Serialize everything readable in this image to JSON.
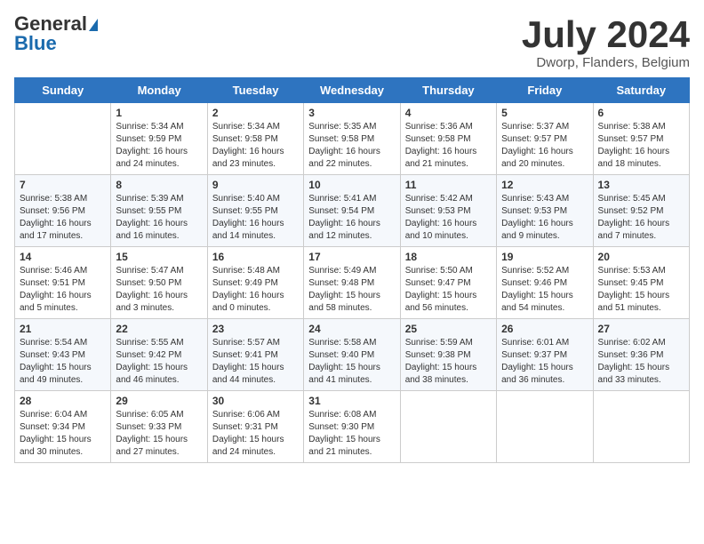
{
  "header": {
    "logo_general": "General",
    "logo_blue": "Blue",
    "month_title": "July 2024",
    "location": "Dworp, Flanders, Belgium"
  },
  "weekdays": [
    "Sunday",
    "Monday",
    "Tuesday",
    "Wednesday",
    "Thursday",
    "Friday",
    "Saturday"
  ],
  "weeks": [
    [
      {
        "day": "",
        "sunrise": "",
        "sunset": "",
        "daylight": ""
      },
      {
        "day": "1",
        "sunrise": "Sunrise: 5:34 AM",
        "sunset": "Sunset: 9:59 PM",
        "daylight": "Daylight: 16 hours and 24 minutes."
      },
      {
        "day": "2",
        "sunrise": "Sunrise: 5:34 AM",
        "sunset": "Sunset: 9:58 PM",
        "daylight": "Daylight: 16 hours and 23 minutes."
      },
      {
        "day": "3",
        "sunrise": "Sunrise: 5:35 AM",
        "sunset": "Sunset: 9:58 PM",
        "daylight": "Daylight: 16 hours and 22 minutes."
      },
      {
        "day": "4",
        "sunrise": "Sunrise: 5:36 AM",
        "sunset": "Sunset: 9:58 PM",
        "daylight": "Daylight: 16 hours and 21 minutes."
      },
      {
        "day": "5",
        "sunrise": "Sunrise: 5:37 AM",
        "sunset": "Sunset: 9:57 PM",
        "daylight": "Daylight: 16 hours and 20 minutes."
      },
      {
        "day": "6",
        "sunrise": "Sunrise: 5:38 AM",
        "sunset": "Sunset: 9:57 PM",
        "daylight": "Daylight: 16 hours and 18 minutes."
      }
    ],
    [
      {
        "day": "7",
        "sunrise": "Sunrise: 5:38 AM",
        "sunset": "Sunset: 9:56 PM",
        "daylight": "Daylight: 16 hours and 17 minutes."
      },
      {
        "day": "8",
        "sunrise": "Sunrise: 5:39 AM",
        "sunset": "Sunset: 9:55 PM",
        "daylight": "Daylight: 16 hours and 16 minutes."
      },
      {
        "day": "9",
        "sunrise": "Sunrise: 5:40 AM",
        "sunset": "Sunset: 9:55 PM",
        "daylight": "Daylight: 16 hours and 14 minutes."
      },
      {
        "day": "10",
        "sunrise": "Sunrise: 5:41 AM",
        "sunset": "Sunset: 9:54 PM",
        "daylight": "Daylight: 16 hours and 12 minutes."
      },
      {
        "day": "11",
        "sunrise": "Sunrise: 5:42 AM",
        "sunset": "Sunset: 9:53 PM",
        "daylight": "Daylight: 16 hours and 10 minutes."
      },
      {
        "day": "12",
        "sunrise": "Sunrise: 5:43 AM",
        "sunset": "Sunset: 9:53 PM",
        "daylight": "Daylight: 16 hours and 9 minutes."
      },
      {
        "day": "13",
        "sunrise": "Sunrise: 5:45 AM",
        "sunset": "Sunset: 9:52 PM",
        "daylight": "Daylight: 16 hours and 7 minutes."
      }
    ],
    [
      {
        "day": "14",
        "sunrise": "Sunrise: 5:46 AM",
        "sunset": "Sunset: 9:51 PM",
        "daylight": "Daylight: 16 hours and 5 minutes."
      },
      {
        "day": "15",
        "sunrise": "Sunrise: 5:47 AM",
        "sunset": "Sunset: 9:50 PM",
        "daylight": "Daylight: 16 hours and 3 minutes."
      },
      {
        "day": "16",
        "sunrise": "Sunrise: 5:48 AM",
        "sunset": "Sunset: 9:49 PM",
        "daylight": "Daylight: 16 hours and 0 minutes."
      },
      {
        "day": "17",
        "sunrise": "Sunrise: 5:49 AM",
        "sunset": "Sunset: 9:48 PM",
        "daylight": "Daylight: 15 hours and 58 minutes."
      },
      {
        "day": "18",
        "sunrise": "Sunrise: 5:50 AM",
        "sunset": "Sunset: 9:47 PM",
        "daylight": "Daylight: 15 hours and 56 minutes."
      },
      {
        "day": "19",
        "sunrise": "Sunrise: 5:52 AM",
        "sunset": "Sunset: 9:46 PM",
        "daylight": "Daylight: 15 hours and 54 minutes."
      },
      {
        "day": "20",
        "sunrise": "Sunrise: 5:53 AM",
        "sunset": "Sunset: 9:45 PM",
        "daylight": "Daylight: 15 hours and 51 minutes."
      }
    ],
    [
      {
        "day": "21",
        "sunrise": "Sunrise: 5:54 AM",
        "sunset": "Sunset: 9:43 PM",
        "daylight": "Daylight: 15 hours and 49 minutes."
      },
      {
        "day": "22",
        "sunrise": "Sunrise: 5:55 AM",
        "sunset": "Sunset: 9:42 PM",
        "daylight": "Daylight: 15 hours and 46 minutes."
      },
      {
        "day": "23",
        "sunrise": "Sunrise: 5:57 AM",
        "sunset": "Sunset: 9:41 PM",
        "daylight": "Daylight: 15 hours and 44 minutes."
      },
      {
        "day": "24",
        "sunrise": "Sunrise: 5:58 AM",
        "sunset": "Sunset: 9:40 PM",
        "daylight": "Daylight: 15 hours and 41 minutes."
      },
      {
        "day": "25",
        "sunrise": "Sunrise: 5:59 AM",
        "sunset": "Sunset: 9:38 PM",
        "daylight": "Daylight: 15 hours and 38 minutes."
      },
      {
        "day": "26",
        "sunrise": "Sunrise: 6:01 AM",
        "sunset": "Sunset: 9:37 PM",
        "daylight": "Daylight: 15 hours and 36 minutes."
      },
      {
        "day": "27",
        "sunrise": "Sunrise: 6:02 AM",
        "sunset": "Sunset: 9:36 PM",
        "daylight": "Daylight: 15 hours and 33 minutes."
      }
    ],
    [
      {
        "day": "28",
        "sunrise": "Sunrise: 6:04 AM",
        "sunset": "Sunset: 9:34 PM",
        "daylight": "Daylight: 15 hours and 30 minutes."
      },
      {
        "day": "29",
        "sunrise": "Sunrise: 6:05 AM",
        "sunset": "Sunset: 9:33 PM",
        "daylight": "Daylight: 15 hours and 27 minutes."
      },
      {
        "day": "30",
        "sunrise": "Sunrise: 6:06 AM",
        "sunset": "Sunset: 9:31 PM",
        "daylight": "Daylight: 15 hours and 24 minutes."
      },
      {
        "day": "31",
        "sunrise": "Sunrise: 6:08 AM",
        "sunset": "Sunset: 9:30 PM",
        "daylight": "Daylight: 15 hours and 21 minutes."
      },
      {
        "day": "",
        "sunrise": "",
        "sunset": "",
        "daylight": ""
      },
      {
        "day": "",
        "sunrise": "",
        "sunset": "",
        "daylight": ""
      },
      {
        "day": "",
        "sunrise": "",
        "sunset": "",
        "daylight": ""
      }
    ]
  ]
}
